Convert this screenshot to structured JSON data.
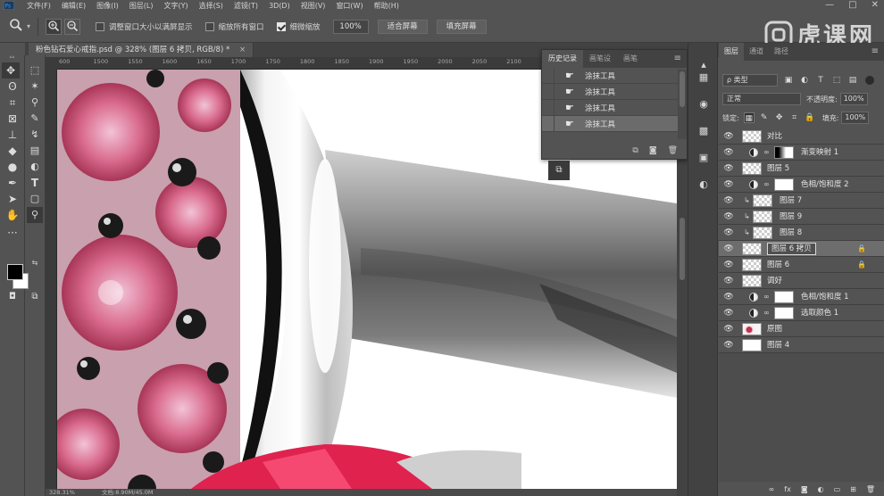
{
  "menubar": {
    "app_icon": "photoshop-logo",
    "items": [
      "文件(F)",
      "编辑(E)",
      "图像(I)",
      "图层(L)",
      "文字(Y)",
      "选择(S)",
      "滤镜(T)",
      "3D(D)",
      "视图(V)",
      "窗口(W)",
      "帮助(H)"
    ],
    "window_controls": [
      "—",
      "□",
      "✕"
    ]
  },
  "options": {
    "tool_icon": "zoom-icon",
    "zoom_in": "+",
    "zoom_out": "−",
    "resize_windows": "调整窗口大小以满屏显示",
    "resize_windows_checked": false,
    "zoom_all": "缩放所有窗口",
    "zoom_all_checked": false,
    "scrubby_zoom": "细微缩放",
    "scrubby_zoom_checked": true,
    "zoom_value": "100%",
    "fit_screen": "适合屏幕",
    "fill_screen": "填充屏幕"
  },
  "watermark": {
    "text": "虎课网"
  },
  "document": {
    "tab_title": "粉色钻石爱心戒指.psd @ 328% (图层 6 拷贝, RGB/8) *",
    "close": "×",
    "ruler_ticks": [
      "600",
      "1500",
      "1550",
      "1600",
      "1650",
      "1700",
      "1750",
      "1800",
      "1850",
      "1900",
      "1950",
      "2000",
      "2050",
      "2100",
      "2150",
      "2200",
      "2250",
      "2300"
    ]
  },
  "status": {
    "zoom": "328.31%",
    "doc_info": "文档:8.90M/45.0M"
  },
  "history": {
    "tabs": [
      "历史记录",
      "画笔设",
      "画笔"
    ],
    "active_tab": 0,
    "menu_icon": "≡",
    "items": [
      {
        "label": "涂抹工具",
        "icon": "smudge-icon"
      },
      {
        "label": "涂抹工具",
        "icon": "smudge-icon"
      },
      {
        "label": "涂抹工具",
        "icon": "smudge-icon"
      },
      {
        "label": "涂抹工具",
        "icon": "smudge-icon"
      }
    ],
    "active_index": 3,
    "footer_icons": [
      "new-doc-from-state-icon",
      "snapshot-icon",
      "trash-icon"
    ]
  },
  "layers": {
    "tabs": [
      "图层",
      "通道",
      "路径"
    ],
    "active_tab": 0,
    "filter_label": "ρ 类型",
    "blend_mode": "正常",
    "opacity_label": "不透明度:",
    "opacity": "100%",
    "lock_label": "锁定:",
    "fill_label": "填充:",
    "fill": "100%",
    "rows": [
      {
        "name": "对比",
        "kind": "group"
      },
      {
        "name": "渐变映射 1",
        "kind": "adjust-grad"
      },
      {
        "name": "图层 5",
        "kind": "layer"
      },
      {
        "name": "色相/饱和度 2",
        "kind": "adjust"
      },
      {
        "name": "图层 7",
        "kind": "clip"
      },
      {
        "name": "图层 9",
        "kind": "clip"
      },
      {
        "name": "图层 8",
        "kind": "clip"
      },
      {
        "name": "图层 6 拷贝",
        "kind": "layer",
        "locked": true,
        "selected": true
      },
      {
        "name": "图层 6",
        "kind": "layer",
        "locked": true
      },
      {
        "name": "调好",
        "kind": "group"
      },
      {
        "name": "色相/饱和度 1",
        "kind": "adjust"
      },
      {
        "name": "选取颜色 1",
        "kind": "adjust"
      },
      {
        "name": "原图",
        "kind": "ring"
      },
      {
        "name": "图层 4",
        "kind": "solid"
      }
    ],
    "footer_icons": [
      "link-icon",
      "fx-icon",
      "mask-icon",
      "adjustment-icon",
      "folder-icon",
      "new-layer-icon",
      "trash-icon"
    ]
  },
  "colors": {
    "foreground": "#000000",
    "background": "#ffffff",
    "accent_gem": "#e0224f"
  }
}
